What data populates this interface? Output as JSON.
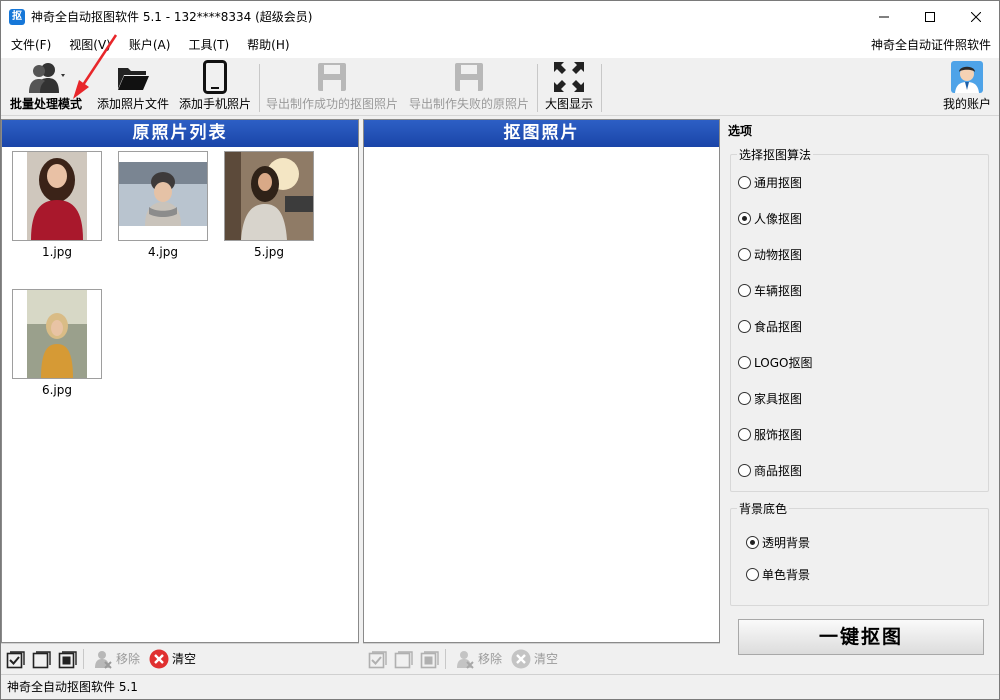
{
  "window": {
    "title": "神奇全自动抠图软件 5.1 - 132****8334 (超级会员)",
    "app_icon_char": "抠"
  },
  "menu": {
    "items": [
      "文件(F)",
      "视图(V)",
      "账户(A)",
      "工具(T)",
      "帮助(H)"
    ],
    "right_link": "神奇全自动证件照软件"
  },
  "toolbar": {
    "batch_mode": "批量处理模式",
    "add_files": "添加照片文件",
    "add_phone": "添加手机照片",
    "export_success": "导出制作成功的抠图照片",
    "export_failed": "导出制作失败的原照片",
    "large_view": "大图显示",
    "my_account": "我的账户"
  },
  "left_panel": {
    "title": "原照片列表",
    "thumbnails": [
      {
        "name": "1.jpg"
      },
      {
        "name": "4.jpg"
      },
      {
        "name": "5.jpg"
      },
      {
        "name": "6.jpg"
      }
    ],
    "bottom": {
      "remove": "移除",
      "clear": "清空"
    }
  },
  "middle_panel": {
    "title": "抠图照片",
    "bottom": {
      "remove": "移除",
      "clear": "清空"
    }
  },
  "options": {
    "title": "选项",
    "algorithm_group": "选择抠图算法",
    "algorithms": [
      "通用抠图",
      "人像抠图",
      "动物抠图",
      "车辆抠图",
      "食品抠图",
      "LOGO抠图",
      "家具抠图",
      "服饰抠图",
      "商品抠图"
    ],
    "selected_algorithm": "人像抠图",
    "background_group": "背景底色",
    "backgrounds": [
      "透明背景",
      "单色背景"
    ],
    "selected_background": "透明背景",
    "action_button": "一键抠图"
  },
  "status": {
    "text": "神奇全自动抠图软件 5.1"
  },
  "colors": {
    "header_blue": "#1f4fb5",
    "clear_red": "#e03030",
    "annotation_arrow": "#e8262a"
  }
}
